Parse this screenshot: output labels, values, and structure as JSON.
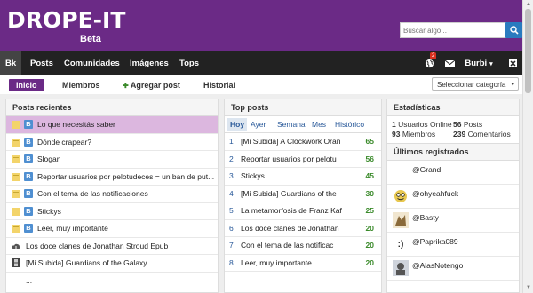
{
  "header": {
    "logo": "DROPE-IT",
    "logo_sub": "Beta",
    "search_placeholder": "Buscar algo..."
  },
  "nav": {
    "items": [
      "Bk",
      "Posts",
      "Comunidades",
      "Imágenes",
      "Tops"
    ],
    "notifications_count": "2",
    "user": "Burbi",
    "user_caret": "▾"
  },
  "subnav": {
    "items": [
      "Inicio",
      "Miembros",
      "Agregar post",
      "Historial"
    ],
    "add_symbol": "✚",
    "category_select": "Seleccionar categoría",
    "caret": "▾"
  },
  "recent_posts": {
    "title": "Posts recientes",
    "items": [
      "Lo que necesitás saber",
      "Dónde crapear?",
      "Slogan",
      "Reportar usuarios por pelotudeces = un ban de put...",
      "Con el tema de las notificaciones",
      "Stickys",
      "Leer, muy importante",
      "Los doce clanes de Jonathan Stroud Epub",
      "[Mi Subida] Guardians of the Galaxy",
      "..."
    ]
  },
  "top_posts": {
    "title": "Top posts",
    "tabs": [
      "Hoy",
      "Ayer",
      "Semana",
      "Mes",
      "Histórico"
    ],
    "items": [
      {
        "rank": "1",
        "title": "[Mi Subida] A Clockwork Oran",
        "score": "65"
      },
      {
        "rank": "2",
        "title": "Reportar usuarios por pelotu",
        "score": "56"
      },
      {
        "rank": "3",
        "title": "Stickys",
        "score": "45"
      },
      {
        "rank": "4",
        "title": "[Mi Subida] Guardians of the",
        "score": "30"
      },
      {
        "rank": "5",
        "title": "La metamorfosis de Franz Kaf",
        "score": "25"
      },
      {
        "rank": "6",
        "title": "Los doce clanes de Jonathan",
        "score": "20"
      },
      {
        "rank": "7",
        "title": "Con el tema de las notificac",
        "score": "20"
      },
      {
        "rank": "8",
        "title": "Leer, muy importante",
        "score": "20"
      }
    ]
  },
  "stats": {
    "title": "Estadísticas",
    "online_num": "1",
    "online_label": "Usuarios Online",
    "posts_num": "56",
    "posts_label": "Posts",
    "members_num": "93",
    "members_label": "Miembros",
    "comments_num": "239",
    "comments_label": "Comentarios"
  },
  "latest": {
    "title": "Últimos registrados",
    "users": [
      "@Grand",
      "@ohyeahfuck",
      "@Basty",
      "@Paprika089",
      "@AlasNotengo"
    ],
    "paprika_avatar_text": ":)"
  },
  "colors": {
    "brand": "#6b2a86",
    "navbar": "#222222",
    "accent_blue": "#4f8fd1",
    "score_green": "#3a8a2a",
    "highlight": "#dcb7df"
  }
}
